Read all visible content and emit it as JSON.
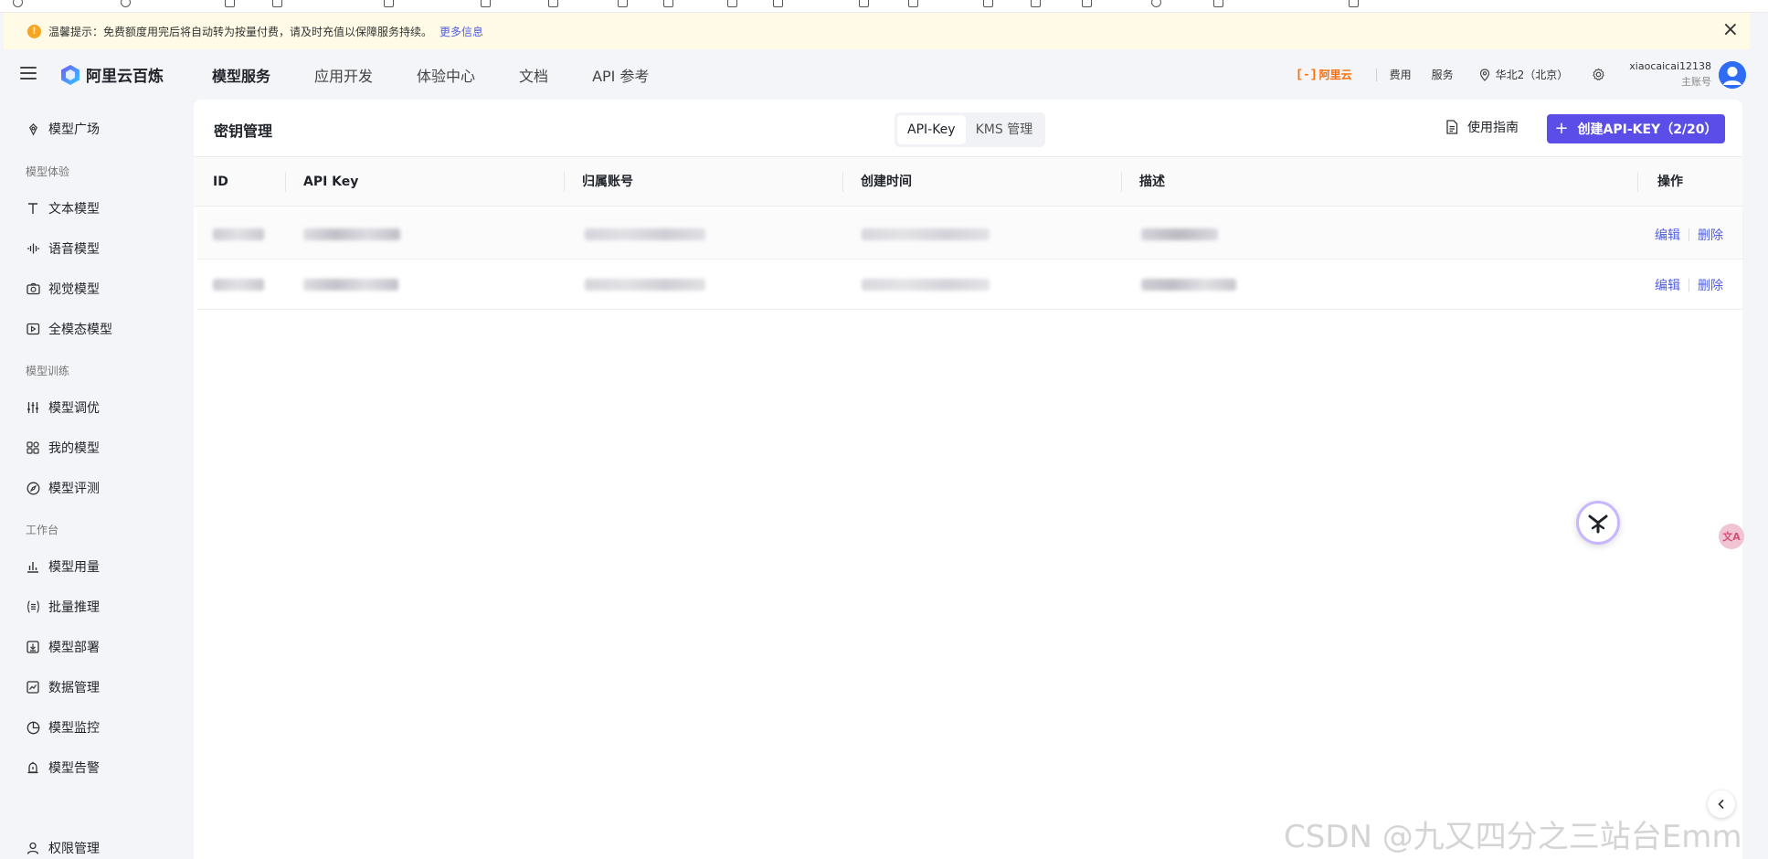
{
  "banner": {
    "text": "温馨提示：免费额度用完后将自动转为按量付费，请及时充值以保障服务持续。",
    "link": "更多信息"
  },
  "brand": {
    "name": "阿里云百炼"
  },
  "nav": {
    "tabs": [
      "模型服务",
      "应用开发",
      "体验中心",
      "文档",
      "API 参考"
    ],
    "aliyun": "阿里云",
    "cost": "费用",
    "service": "服务",
    "region": "华北2（北京）",
    "username": "xiaocaicai12138",
    "role": "主账号"
  },
  "sidebar": {
    "top_item": "模型广场",
    "groups": [
      {
        "title": "模型体验",
        "items": [
          "文本模型",
          "语音模型",
          "视觉模型",
          "全模态模型"
        ]
      },
      {
        "title": "模型训练",
        "items": [
          "模型调优",
          "我的模型",
          "模型评测"
        ]
      },
      {
        "title": "工作台",
        "items": [
          "模型用量",
          "批量推理",
          "模型部署",
          "数据管理",
          "模型监控",
          "模型告警"
        ]
      }
    ],
    "bottom_item": "权限管理"
  },
  "page": {
    "title": "密钥管理",
    "segments": [
      "API-Key",
      "KMS 管理"
    ],
    "guide": "使用指南",
    "create": "创建API-KEY（2/20）"
  },
  "table": {
    "columns": [
      "ID",
      "API Key",
      "归属账号",
      "创建时间",
      "描述",
      "操作"
    ],
    "actions": {
      "edit": "编辑",
      "delete": "删除"
    }
  },
  "watermark": "CSDN @九又四分之三站台Emm",
  "colors": {
    "primary": "#5b4ee8",
    "link": "#4e5de3",
    "brand_orange": "#ff6a00",
    "banner_bg": "#fffbe6"
  }
}
